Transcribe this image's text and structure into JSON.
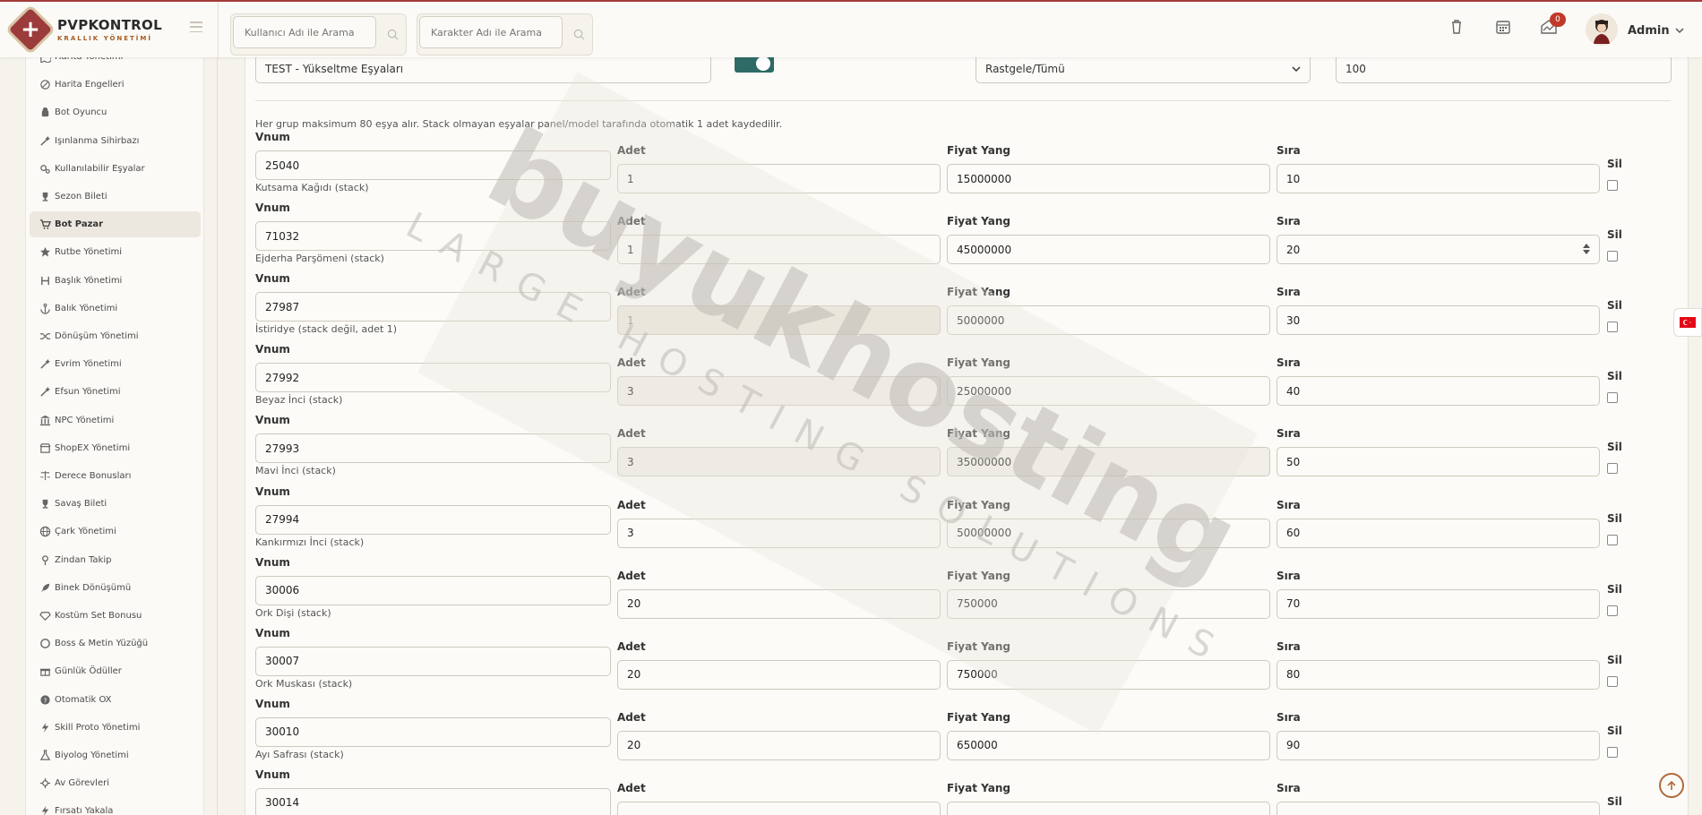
{
  "brand": {
    "title": "PVPKONTROL",
    "subtitle": "KRALLIK YÖNETİMİ"
  },
  "header": {
    "search_user_placeholder": "Kullanıcı Adı ile Arama",
    "search_char_placeholder": "Karakter Adı ile Arama",
    "notifications_count": "0",
    "admin_name": "Admin"
  },
  "sidebar": {
    "items": [
      {
        "label": "Harita Yönetimi",
        "icon": "map-icon"
      },
      {
        "label": "Harita Engelleri",
        "icon": "ban-icon"
      },
      {
        "label": "Bot Oyuncu",
        "icon": "android-icon"
      },
      {
        "label": "Işınlanma Sihirbazı",
        "icon": "wand-icon"
      },
      {
        "label": "Kullanılabilir Eşyalar",
        "icon": "gears-icon"
      },
      {
        "label": "Sezon Bileti",
        "icon": "trophy-icon"
      },
      {
        "label": "Bot Pazar",
        "icon": "cart-icon",
        "active": true
      },
      {
        "label": "Rutbe Yönetimi",
        "icon": "star-icon"
      },
      {
        "label": "Başlık Yönetimi",
        "icon": "heading-icon"
      },
      {
        "label": "Balık Yönetimi",
        "icon": "anchor-icon"
      },
      {
        "label": "Dönüşüm Yönetimi",
        "icon": "shuffle-icon"
      },
      {
        "label": "Evrim Yönetimi",
        "icon": "wand-icon"
      },
      {
        "label": "Efsun Yönetimi",
        "icon": "wand-icon"
      },
      {
        "label": "NPC Yönetimi",
        "icon": "bank-icon"
      },
      {
        "label": "ShopEX Yönetimi",
        "icon": "shop-icon"
      },
      {
        "label": "Derece Bonusları",
        "icon": "balance-icon"
      },
      {
        "label": "Savaş Bileti",
        "icon": "trophy-icon"
      },
      {
        "label": "Çark Yönetimi",
        "icon": "globe-icon"
      },
      {
        "label": "Zindan Takip",
        "icon": "pin-icon"
      },
      {
        "label": "Binek Dönüşümü",
        "icon": "rocket-icon"
      },
      {
        "label": "Kostüm Set Bonusu",
        "icon": "diamond-icon"
      },
      {
        "label": "Boss & Metin Yüzüğü",
        "icon": "ring-icon"
      },
      {
        "label": "Günlük Ödüller",
        "icon": "gift-icon"
      },
      {
        "label": "Otomatik OX",
        "icon": "question-icon"
      },
      {
        "label": "Skill Proto Yönetimi",
        "icon": "bolt-icon"
      },
      {
        "label": "Biyolog Yönetimi",
        "icon": "flask-icon"
      },
      {
        "label": "Av Görevleri",
        "icon": "crosshair-icon"
      },
      {
        "label": "Fırsatı Yakala",
        "icon": "bolt-icon"
      }
    ]
  },
  "form": {
    "group_name": "TEST - Yükseltme Eşyaları",
    "category_select": "Rastgele/Tümü",
    "order_value": "100",
    "toggle_on": true,
    "note": "Her grup maksimum 80 eşya alır. Stack olmayan eşyalar panel/model tarafında otomatik 1 adet kaydedilir.",
    "labels": {
      "vnum": "Vnum",
      "adet": "Adet",
      "fiyat": "Fiyat Yang",
      "sira": "Sıra",
      "sil": "Sil"
    }
  },
  "items": [
    {
      "vnum": "25040",
      "name": "Kutsama Kağıdı (stack)",
      "adet": "1",
      "fiyat": "15000000",
      "sira": "10"
    },
    {
      "vnum": "71032",
      "name": "Ejderha Parşömeni (stack)",
      "adet": "1",
      "fiyat": "45000000",
      "sira": "20"
    },
    {
      "vnum": "27987",
      "name": "İstiridye (stack değil, adet 1)",
      "adet": "1",
      "fiyat": "5000000",
      "sira": "30"
    },
    {
      "vnum": "27992",
      "name": "Beyaz İnci (stack)",
      "adet": "3",
      "fiyat": "25000000",
      "sira": "40"
    },
    {
      "vnum": "27993",
      "name": "Mavi İnci (stack)",
      "adet": "3",
      "fiyat": "35000000",
      "sira": "50"
    },
    {
      "vnum": "27994",
      "name": "Kankırmızı İnci (stack)",
      "adet": "3",
      "fiyat": "50000000",
      "sira": "60"
    },
    {
      "vnum": "30006",
      "name": "Ork Dişi (stack)",
      "adet": "20",
      "fiyat": "750000",
      "sira": "70"
    },
    {
      "vnum": "30007",
      "name": "Ork Muskası (stack)",
      "adet": "20",
      "fiyat": "750000",
      "sira": "80"
    },
    {
      "vnum": "30010",
      "name": "Ayı Safrası (stack)",
      "adet": "20",
      "fiyat": "650000",
      "sira": "90"
    },
    {
      "vnum": "30014",
      "name": "",
      "adet": "",
      "fiyat": "",
      "sira": ""
    }
  ],
  "watermark": {
    "main": "buyukhosting",
    "sub": "LARGE HOSTING SOLUTIONS"
  },
  "colors": {
    "accent": "#9c3b3b",
    "toggle": "#2f6b66",
    "background": "#f6f3ec"
  }
}
